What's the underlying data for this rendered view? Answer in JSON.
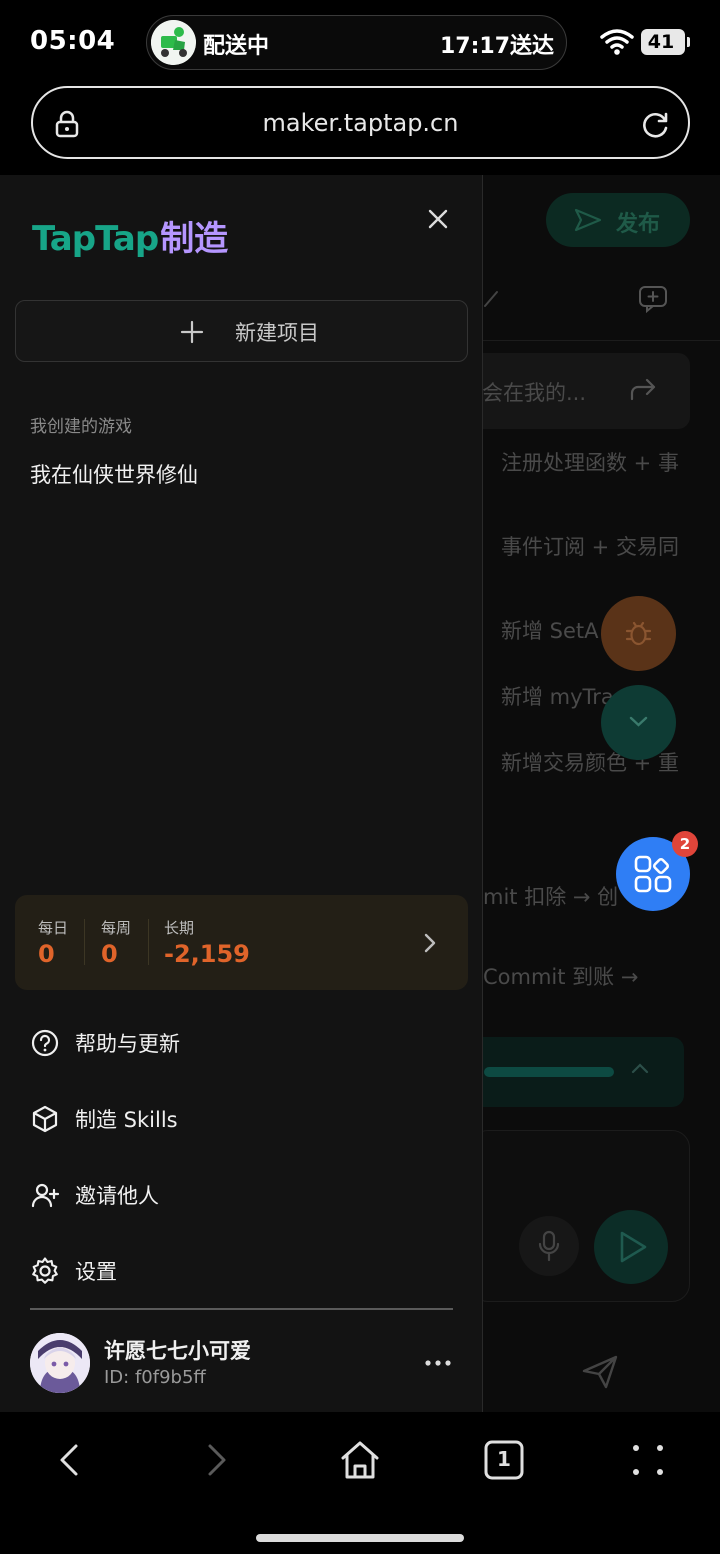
{
  "status_bar": {
    "time": "05:04",
    "delivery_label": "配送中",
    "delivery_eta": "17:17送达",
    "battery": "41"
  },
  "browser": {
    "url": "maker.taptap.cn"
  },
  "background_page": {
    "publish_label": "发布",
    "quote_text": "会在我的...",
    "lines": [
      "注册处理函数 + 事",
      "事件订阅 + 交易同",
      "新增 SetA",
      "新增 myTra",
      "新增交易颜色 + 重",
      "mit 扣除 → 创",
      "Commit 到账 →"
    ],
    "notification_badge": "2"
  },
  "drawer": {
    "brand_primary": "TapTap",
    "brand_secondary": "制造",
    "new_project_label": "新建项目",
    "section_title": "我创建的游戏",
    "games": [
      "我在仙侠世界修仙"
    ],
    "points": {
      "daily_label": "每日",
      "daily_value": "0",
      "weekly_label": "每周",
      "weekly_value": "0",
      "long_label": "长期",
      "long_value": "-2,159"
    },
    "menu": {
      "help": "帮助与更新",
      "skills": "制造 Skills",
      "invite": "邀请他人",
      "settings": "设置"
    },
    "profile": {
      "name": "许愿七七小可爱",
      "id": "ID: f0f9b5ff"
    }
  },
  "nav": {
    "tab_count": "1"
  },
  "colors": {
    "brand_green": "#17a588",
    "brand_purple": "#b596ff",
    "points_orange": "#e0642a",
    "fab_blue": "#2f7ef5",
    "badge_red": "#e0453a"
  }
}
